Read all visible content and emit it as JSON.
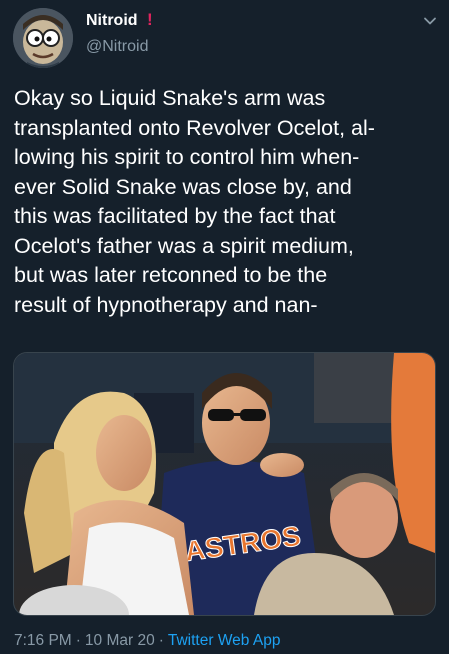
{
  "author": {
    "display_name": "Nitroid",
    "flag_glyph": "!",
    "handle": "@Nitroid",
    "avatar_icon": "cartoon-face-avatar"
  },
  "menu": {
    "icon": "chevron-down-icon"
  },
  "tweet": {
    "lines": [
      "Okay so Liquid Snake's arm was",
      "transplanted onto Revolver Ocelot, al-",
      "lowing his spirit to control him when-",
      "ever Solid Snake was close by, and",
      "this was facilitated by the fact that",
      "Ocelot's father was a spirit medium,",
      "but was later retconned to be the",
      "result of hypnotherapy and nan-"
    ]
  },
  "media": {
    "shirt_text": "ASTROS"
  },
  "footer": {
    "time": "7:16 PM",
    "separator": "·",
    "date": "10 Mar 20",
    "source": "Twitter Web App"
  },
  "colors": {
    "background": "#15202b",
    "secondary_text": "#8899a6",
    "link": "#1da1f2",
    "flag": "#e0245e"
  }
}
